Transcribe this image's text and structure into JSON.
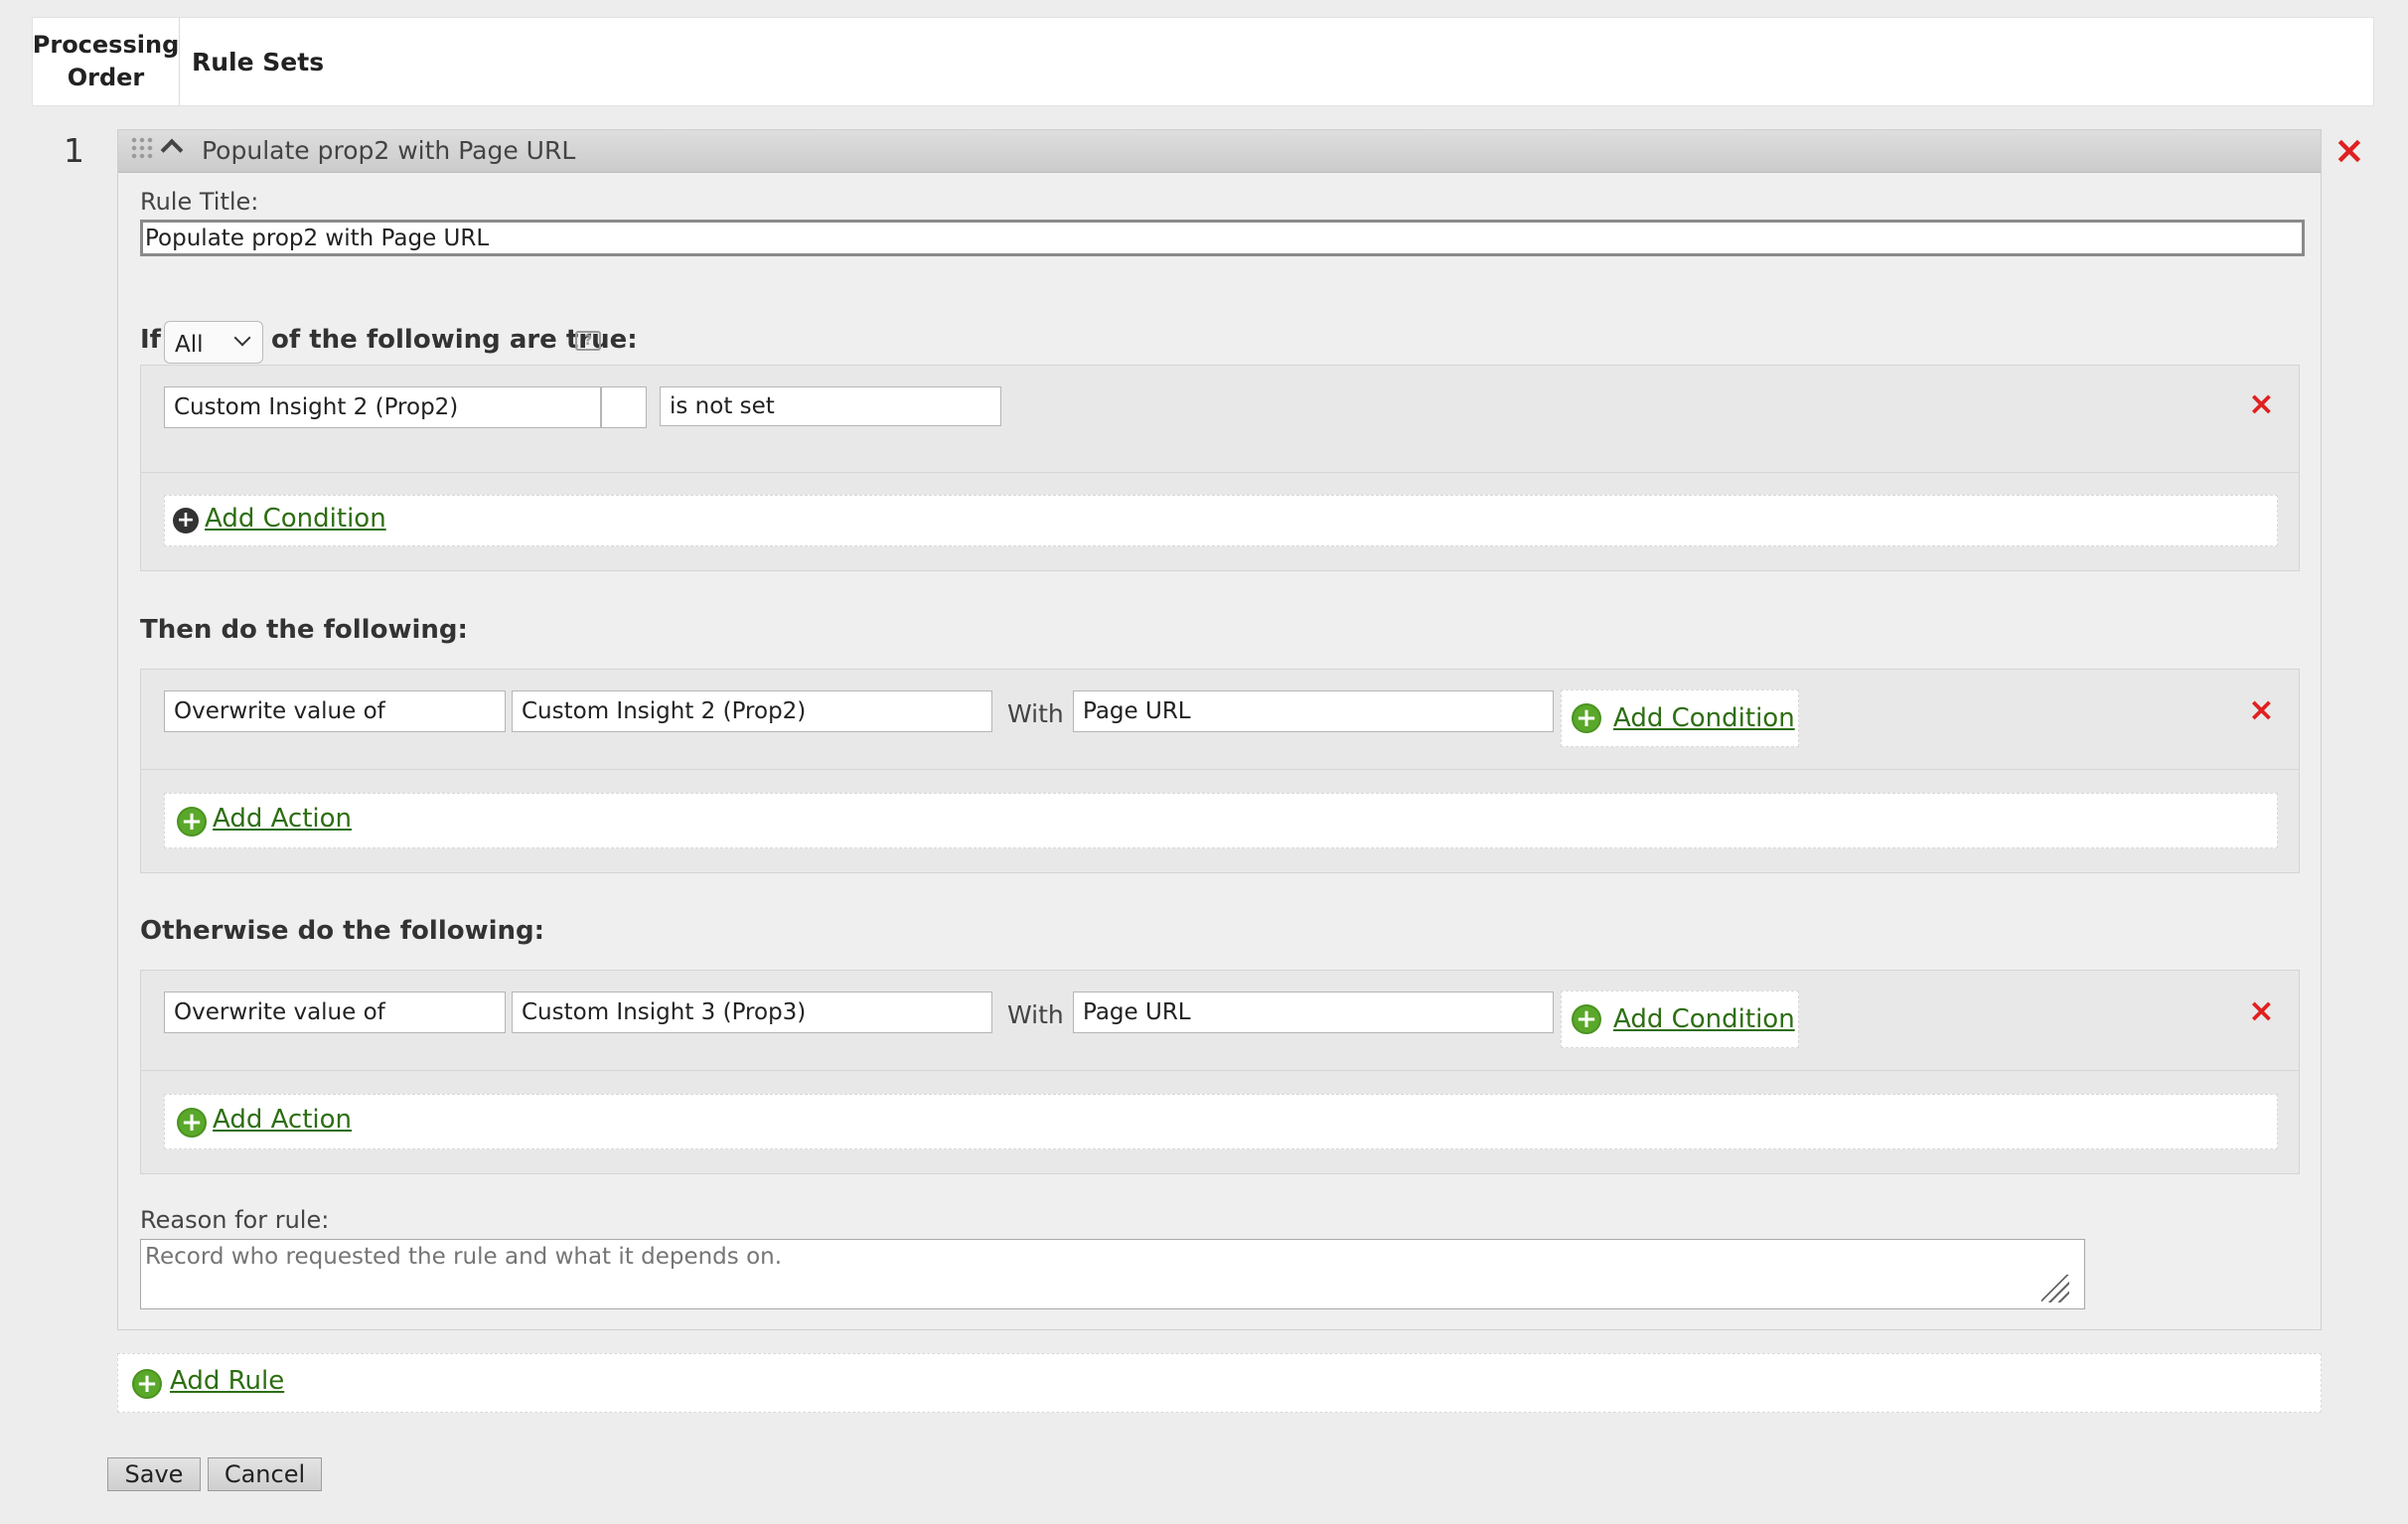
{
  "header": {
    "processing_order_line1": "Processing",
    "processing_order_line2": "Order",
    "rule_sets": "Rule Sets"
  },
  "rule": {
    "order_number": "1",
    "bar_title": "Populate prop2 with Page URL",
    "remove_icon": "×",
    "title_label": "Rule Title:",
    "title_value": "Populate prop2 with Page URL",
    "if_label": "If",
    "match_select": "All",
    "following_label": "of the following are true:",
    "help_icon": "?",
    "condition": {
      "variable": "Custom Insight 2 (Prop2)",
      "operator": "is not set",
      "remove_icon": "×"
    },
    "add_condition": "Add Condition",
    "then_label": "Then do the following:",
    "then_action": {
      "action": "Overwrite value of",
      "target": "Custom Insight 2 (Prop2)",
      "with": "With",
      "value": "Page URL",
      "add_condition": "Add Condition",
      "remove_icon": "×"
    },
    "add_action": "Add Action",
    "otherwise_label": "Otherwise do the following:",
    "otherwise_action": {
      "action": "Overwrite value of",
      "target": "Custom Insight 3 (Prop3)",
      "with": "With",
      "value": "Page URL",
      "add_condition": "Add Condition",
      "remove_icon": "×"
    },
    "add_action_2": "Add Action",
    "reason_label": "Reason for rule:",
    "reason_placeholder": "Record who requested the rule and what it depends on."
  },
  "add_rule": "Add Rule",
  "buttons": {
    "save": "Save",
    "cancel": "Cancel"
  },
  "icons": {
    "plus": "+"
  }
}
